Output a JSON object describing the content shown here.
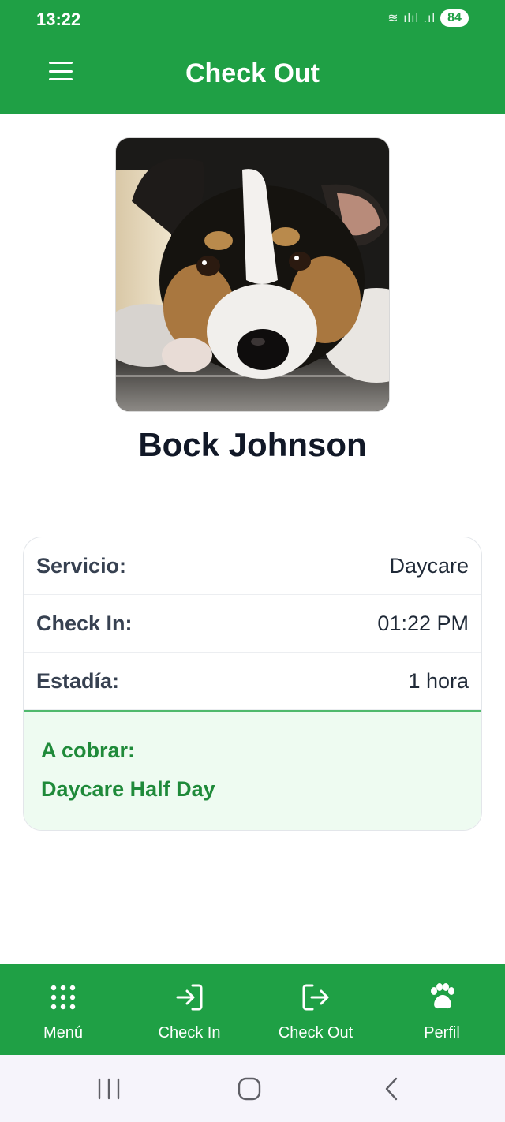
{
  "status_bar": {
    "time": "13:22",
    "signal_glyphs": "≋ ılıl .ıl",
    "battery": "84"
  },
  "header": {
    "title": "Check Out",
    "menu_icon": "hamburger-menu-icon",
    "background_color": "#1fa045"
  },
  "pet": {
    "name": "Bock Johnson",
    "photo_description_icon": "dog-photo"
  },
  "details": {
    "rows": [
      {
        "label": "Servicio:",
        "value": "Daycare"
      },
      {
        "label": "Check In:",
        "value": "01:22 PM"
      },
      {
        "label": "Estadía:",
        "value": "1 hora"
      }
    ],
    "charge_label": "A cobrar:",
    "charge_value": "Daycare Half Day",
    "charge_color": "#1f8a3a"
  },
  "bottom_nav": {
    "items": [
      {
        "label": "Menú",
        "icon": "grid-dots-icon"
      },
      {
        "label": "Check In",
        "icon": "login-arrow-icon"
      },
      {
        "label": "Check Out",
        "icon": "logout-arrow-icon"
      },
      {
        "label": "Perfil",
        "icon": "paw-icon"
      }
    ]
  },
  "system_nav": {
    "buttons": [
      "recents-icon",
      "home-icon",
      "back-icon"
    ]
  }
}
